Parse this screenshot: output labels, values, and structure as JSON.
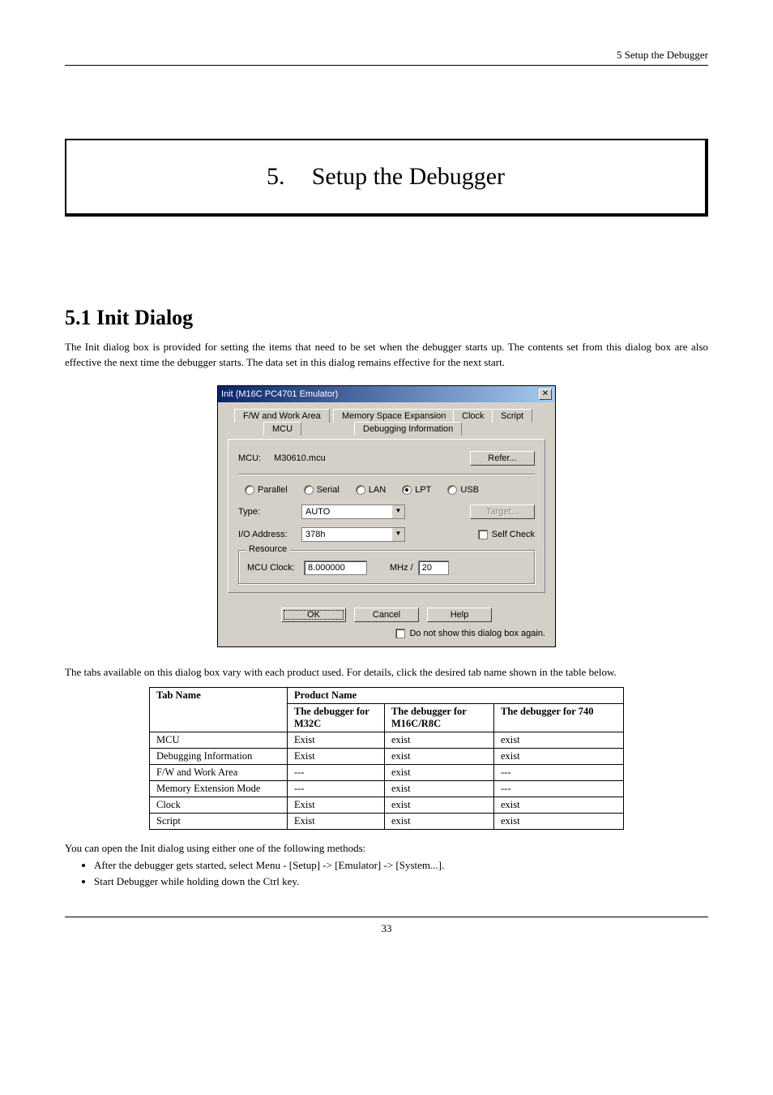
{
  "header": {
    "right": "5 Setup the Debugger"
  },
  "chapter": {
    "num": "5.",
    "title": "Setup the Debugger"
  },
  "section": {
    "heading": "5.1 Init Dialog"
  },
  "para1": "The Init dialog box is provided for setting the items that need to be set when the debugger starts up. The contents set from this dialog box are also effective the next time the debugger starts. The data set in this dialog remains effective for the next start.",
  "dialog": {
    "title": "Init (M16C PC4701 Emulator)",
    "tabs": {
      "fw": "F/W and Work Area",
      "mem": "Memory Space Expansion",
      "clock": "Clock",
      "script": "Script",
      "mcu": "MCU",
      "dbg": "Debugging Information"
    },
    "mcu_label": "MCU:",
    "mcu_value": "M30610.mcu",
    "refer": "Refer...",
    "radios": {
      "parallel": "Parallel",
      "serial": "Serial",
      "lan": "LAN",
      "lpt": "LPT",
      "usb": "USB"
    },
    "type_label": "Type:",
    "type_value": "AUTO",
    "io_label": "I/O Address:",
    "io_value": "378h",
    "target": "Target...",
    "selfcheck": "Self Check",
    "resource": {
      "legend": "Resource",
      "clock_label": "MCU Clock:",
      "clock_value": "8.000000",
      "mhz": "MHz /",
      "div": "20"
    },
    "ok": "OK",
    "cancel": "Cancel",
    "help": "Help",
    "donot": "Do not show this dialog box again."
  },
  "para2": "The tabs available on this dialog box vary with each product used. For details, click the desired tab name shown in the table below.",
  "table": {
    "h1": "Tab Name",
    "h2": "Product Name",
    "h3": "The debugger for M32C",
    "h4": "The debugger for M16C/R8C",
    "h5": "The debugger for 740",
    "rows": [
      {
        "c0": "MCU",
        "c1": "Exist",
        "c2": "exist",
        "c3": "exist"
      },
      {
        "c0": "Debugging Information",
        "c1": "Exist",
        "c2": "exist",
        "c3": "exist"
      },
      {
        "c0": "F/W and Work Area",
        "c1": "---",
        "c2": "exist",
        "c3": "---"
      },
      {
        "c0": "Memory Extension Mode",
        "c1": "---",
        "c2": "exist",
        "c3": "---"
      },
      {
        "c0": "Clock",
        "c1": "Exist",
        "c2": "exist",
        "c3": "exist"
      },
      {
        "c0": "Script",
        "c1": "Exist",
        "c2": "exist",
        "c3": "exist"
      }
    ]
  },
  "para3": "You can open the Init dialog using either one of the following methods:",
  "bullets": [
    "After the debugger gets started, select Menu - [Setup] -> [Emulator] -> [System...].",
    "Start Debugger while holding down the Ctrl key."
  ],
  "page_num": "33"
}
